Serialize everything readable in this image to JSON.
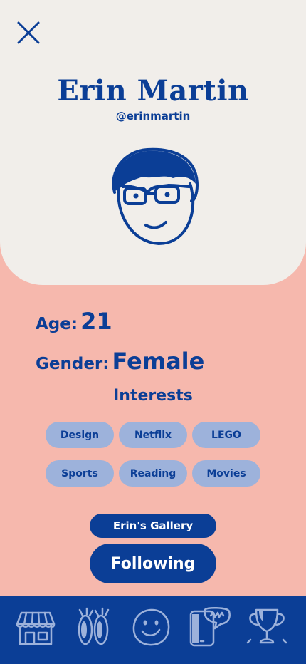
{
  "profile": {
    "name": "Erin Martin",
    "handle": "@erinmartin",
    "age_label": "Age:",
    "age_value": "21",
    "gender_label": "Gender:",
    "gender_value": "Female"
  },
  "interests": {
    "title": "Interests",
    "items": [
      "Design",
      "Netflix",
      "LEGO",
      "Sports",
      "Reading",
      "Movies"
    ]
  },
  "actions": {
    "gallery_label": "Erin's Gallery",
    "follow_label": "Following"
  },
  "icons": {
    "close": "close-icon",
    "avatar": "avatar-icon",
    "tabs": [
      "store-icon",
      "bunny-ears-icon",
      "smiley-face-icon",
      "phone-chat-icon",
      "trophy-icon"
    ]
  },
  "colors": {
    "primary": "#0b3e96",
    "background": "#f6b8ad",
    "card": "#f1eeea",
    "chip": "#9db2db"
  }
}
